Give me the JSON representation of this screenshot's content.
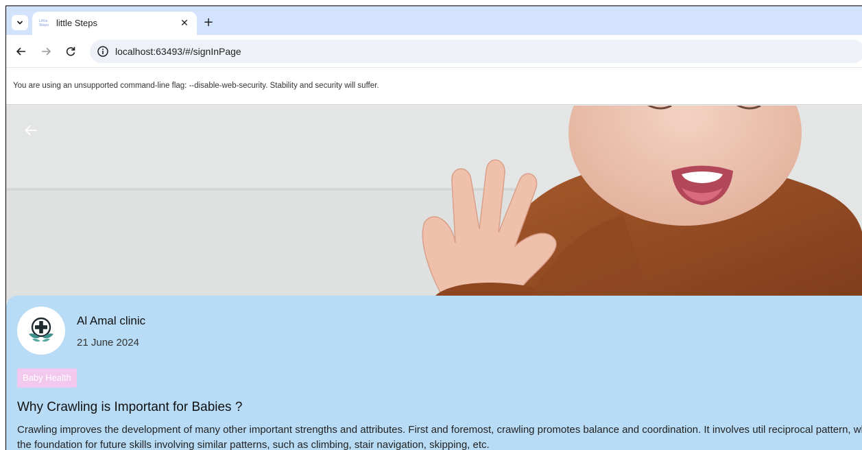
{
  "browser": {
    "tab": {
      "favicon_text": "Little Steps",
      "title": "little Steps"
    },
    "tab_menu_icon": "chevron-down-icon",
    "tab_close_icon": "close-icon",
    "new_tab_icon": "plus-icon",
    "nav": {
      "back_icon": "arrow-left-icon",
      "forward_icon": "arrow-right-icon",
      "reload_icon": "reload-icon"
    },
    "url": "localhost:63493/#/signInPage",
    "infobar_text": "You are using an unsupported command-line flag: --disable-web-security. Stability and security will suffer."
  },
  "page": {
    "back_icon": "arrow-left-icon",
    "hero_image": "baby-photo",
    "clinic": {
      "name": "Al Amal clinic",
      "date": "21 June 2024",
      "logo_icon": "clinic-logo-icon"
    },
    "tag": "Baby Health",
    "article": {
      "title": "Why Crawling is Important for Babies ?",
      "body": "Crawling improves the development of many other important strengths and attributes. First and foremost, crawling promotes balance and coordination. It involves util reciprocal pattern, which lays the foundation for future skills involving similar patterns, such as climbing, stair navigation, skipping, etc."
    }
  },
  "colors": {
    "tabstrip": "#d3e3fd",
    "card_background": "#b9dcf6",
    "tag_background": "#f3c8ef",
    "logo_teal": "#3f8f8c",
    "logo_dark": "#1f2a30"
  }
}
